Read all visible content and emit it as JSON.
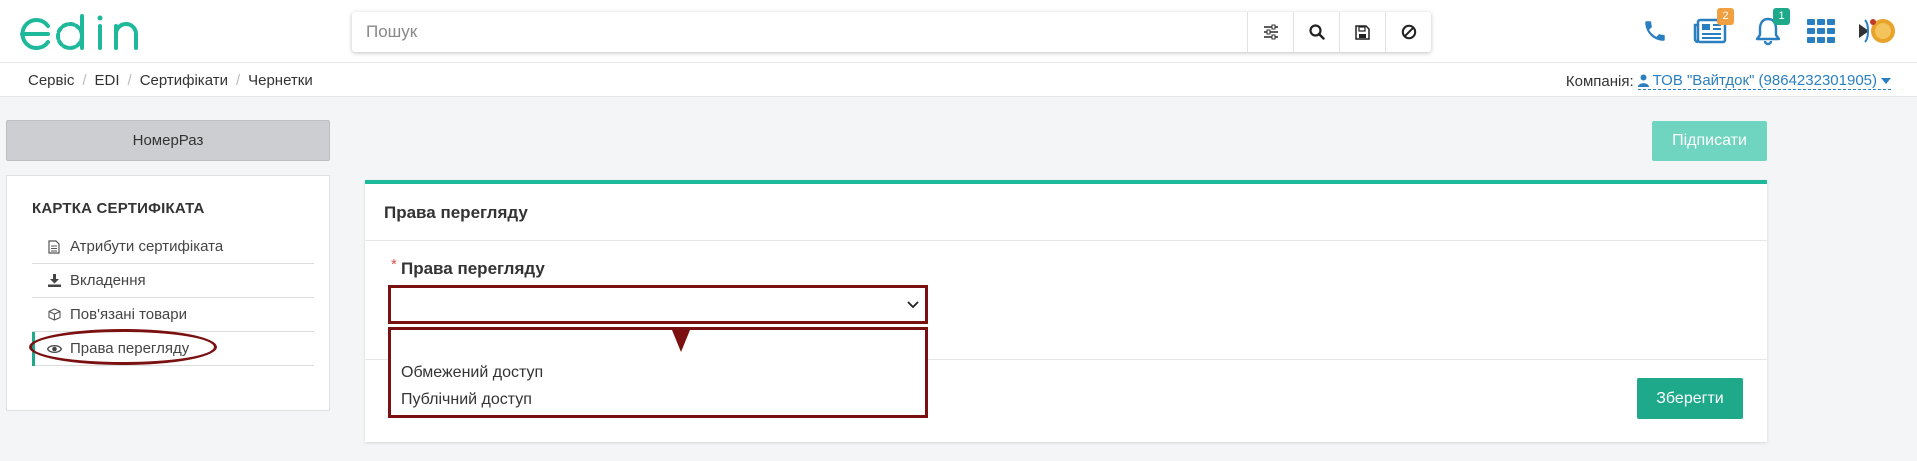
{
  "header": {
    "logo_text": "edin",
    "search": {
      "placeholder": "Пошук",
      "value": ""
    },
    "badges": {
      "news": "2",
      "notifications": "1"
    }
  },
  "breadcrumbs": [
    "Сервіс",
    "EDI",
    "Сертифікати",
    "Чернетки"
  ],
  "company": {
    "label": "Компанія:",
    "value": "ТОВ \"Вайтдок\" (9864232301905)"
  },
  "sidebar": {
    "number_button": "НомерРаз",
    "card_title": "КАРТКА СЕРТИФІКАТА",
    "items": [
      {
        "label": "Атрибути сертифіката",
        "icon": "document-icon"
      },
      {
        "label": "Вкладення",
        "icon": "download-icon"
      },
      {
        "label": "Пов'язані товари",
        "icon": "box-icon"
      },
      {
        "label": "Права перегляду",
        "icon": "eye-icon",
        "active": true
      }
    ]
  },
  "main": {
    "sign_button": "Підписати",
    "panel_title": "Права перегляду",
    "field": {
      "required_mark": "*",
      "label": "Права перегляду",
      "selected": "",
      "options": [
        "Обмежений доступ",
        "Публічний доступ"
      ]
    },
    "save_button": "Зберегти"
  },
  "colors": {
    "accent": "#1eaa8a",
    "accent_light": "#6fd5c1",
    "link": "#2a7fc0",
    "highlight": "#7b1010",
    "badge_orange": "#f0a040",
    "badge_teal": "#1eaa8a"
  }
}
